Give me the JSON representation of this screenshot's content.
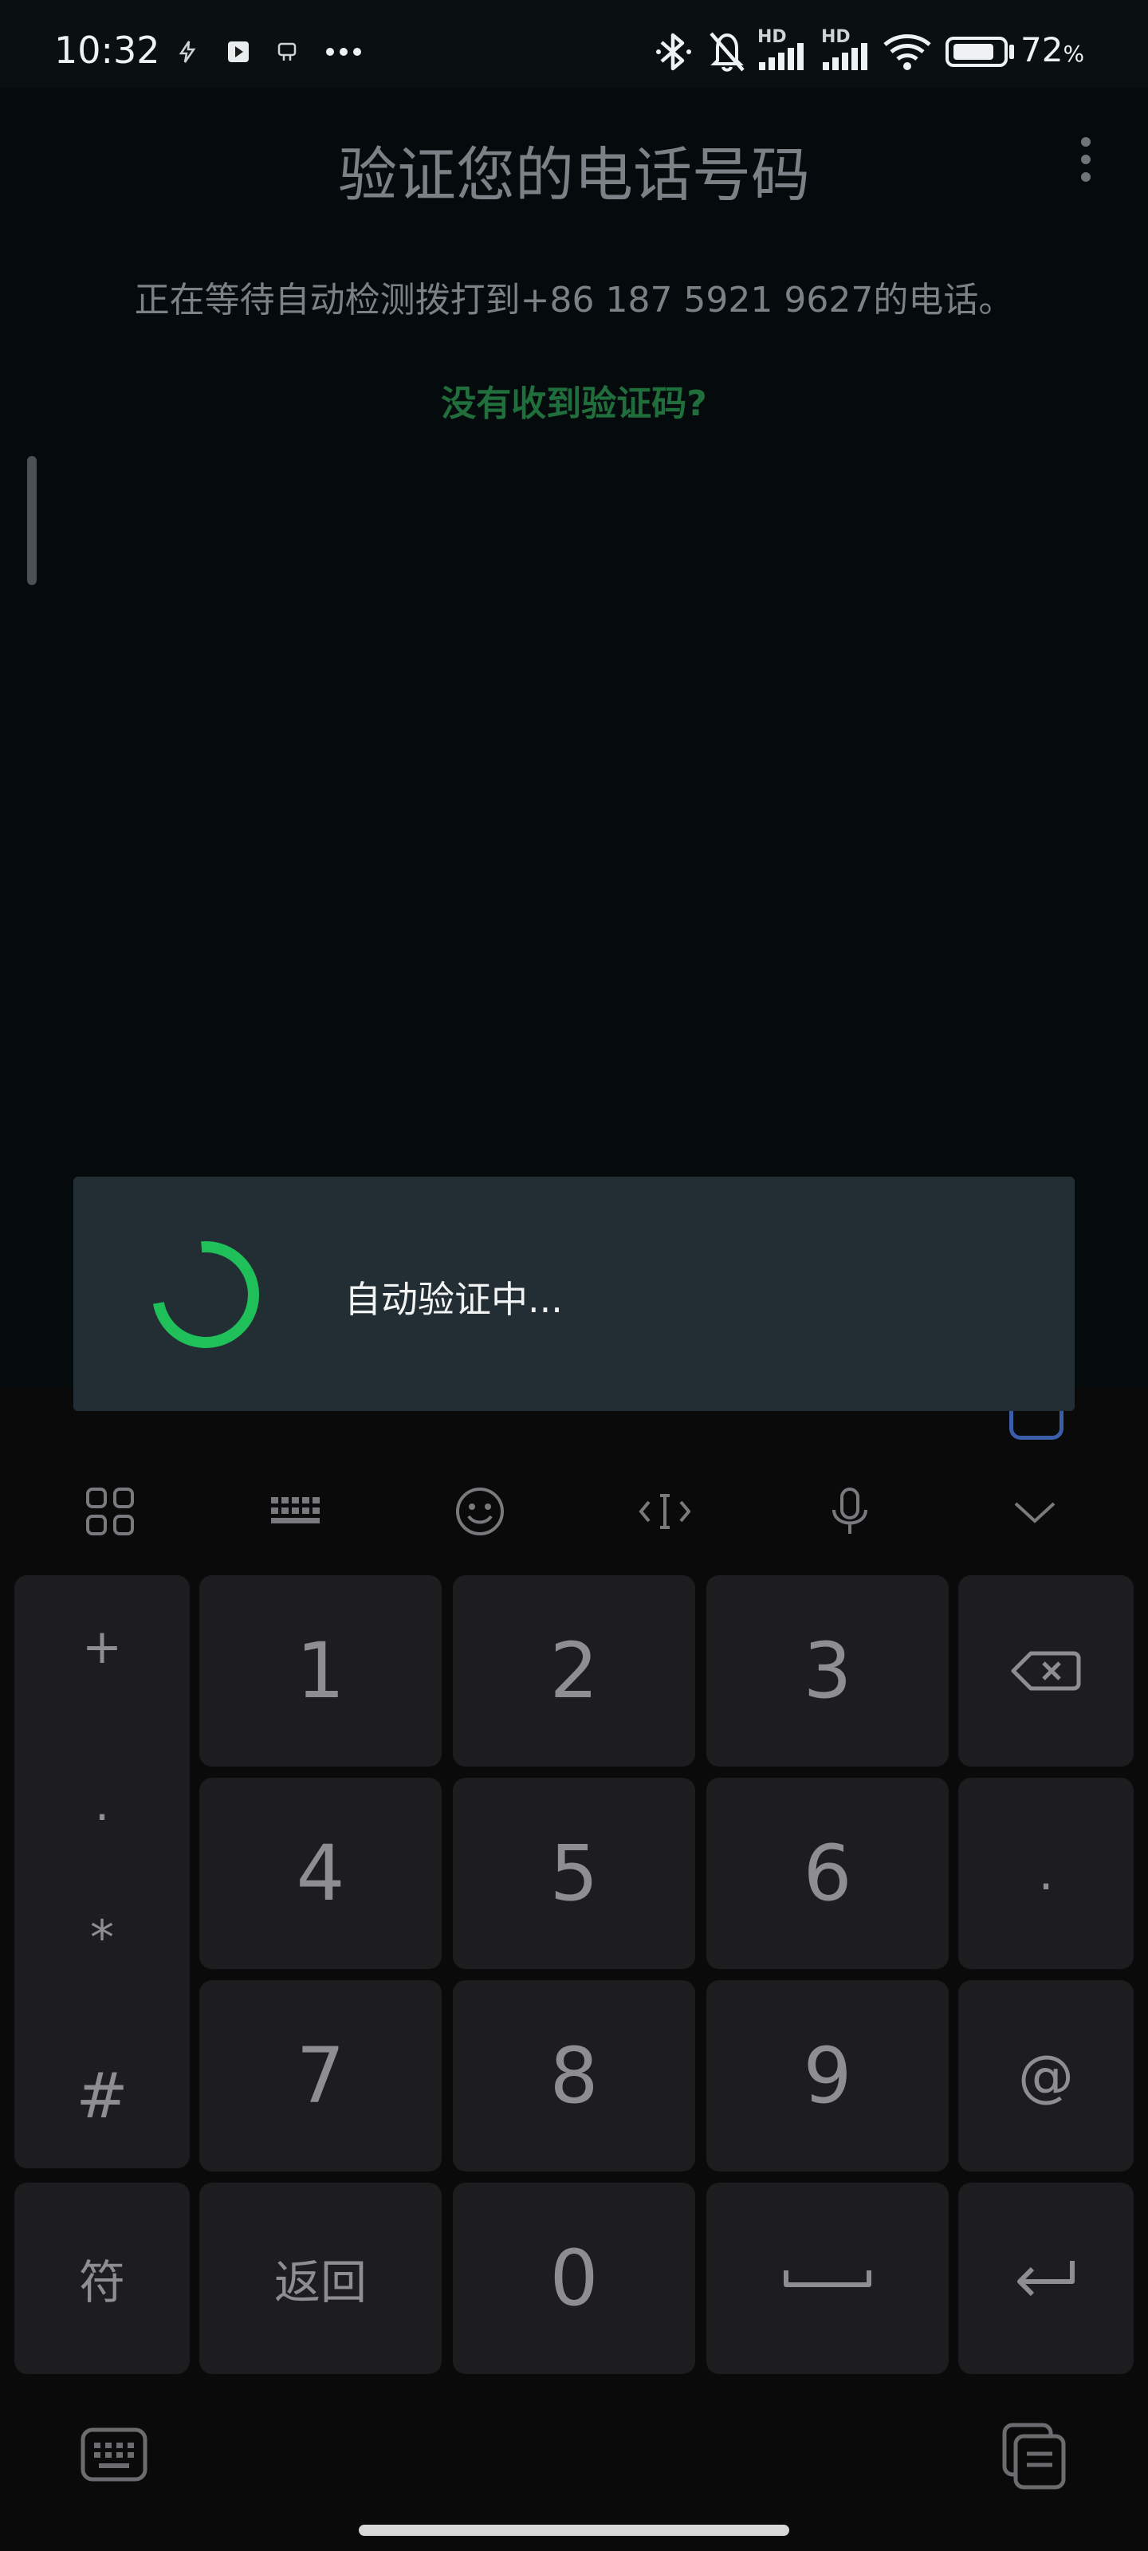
{
  "status_bar": {
    "time": "10:32",
    "net1": "HD",
    "net2": "HD",
    "battery": "72",
    "battery_unit": "%"
  },
  "header": {
    "title": "验证您的电话号码",
    "menu_icon": "more-vert-icon"
  },
  "main": {
    "waiting_text": "正在等待自动检测拨打到+86 187 5921 9627的电话。",
    "no_code_link": "没有收到验证码?"
  },
  "dialog": {
    "text": "自动验证中...",
    "accent": "#1fc05a"
  },
  "keyboard": {
    "toolbar": [
      "apps-grid-icon",
      "keyboard-icon",
      "emoji-icon",
      "cursor-icon",
      "mic-icon",
      "chevron-down-icon"
    ],
    "left_column": {
      "plus": "+",
      "dot": "·",
      "star": "*",
      "hash": "#",
      "symbols": "符"
    },
    "keys": [
      "1",
      "2",
      "3",
      "4",
      "5",
      "6",
      "7",
      "8",
      "9",
      "0"
    ],
    "dot_key": ".",
    "at_key": "@",
    "back_key": "返回"
  }
}
